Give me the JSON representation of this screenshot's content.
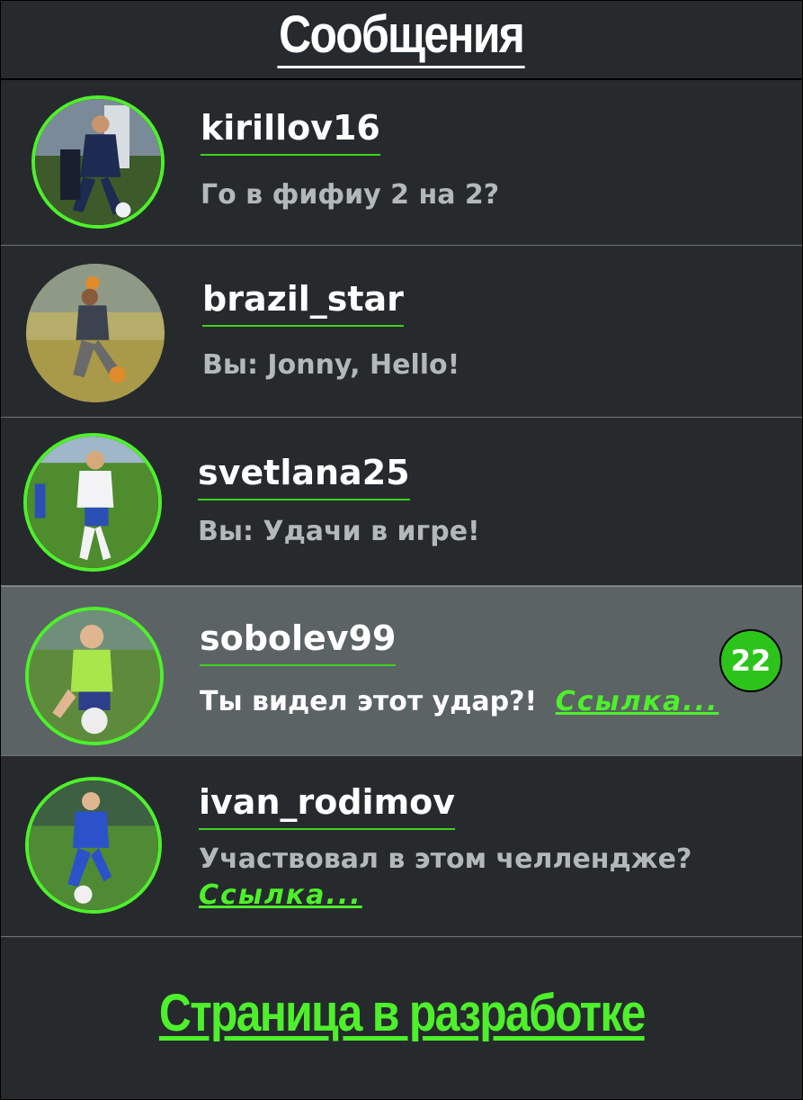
{
  "header": {
    "title": "Сообщения"
  },
  "conversations": [
    {
      "username": "kirillov16",
      "preview": "Го в фифиу 2 на 2?",
      "link": "",
      "unread": ""
    },
    {
      "username": "brazil_star",
      "preview": "Вы: Jonny, Hello!",
      "link": "",
      "unread": ""
    },
    {
      "username": "svetlana25",
      "preview": "Вы: Удачи в игре!",
      "link": "",
      "unread": ""
    },
    {
      "username": "sobolev99",
      "preview": "Ты видел этот удар?!",
      "link": "Ссылка...",
      "unread": "22"
    },
    {
      "username": "ivan_rodimov",
      "preview": "Участвовал в этом челлендже?",
      "link": "Ссылка...",
      "unread": ""
    }
  ],
  "footer": {
    "status": "Страница в разработке"
  },
  "colors": {
    "accent": "#4ef02c",
    "background": "#262a2d",
    "active_row": "#5b6364"
  },
  "icons": {
    "avatar": "user-avatar-photo"
  }
}
